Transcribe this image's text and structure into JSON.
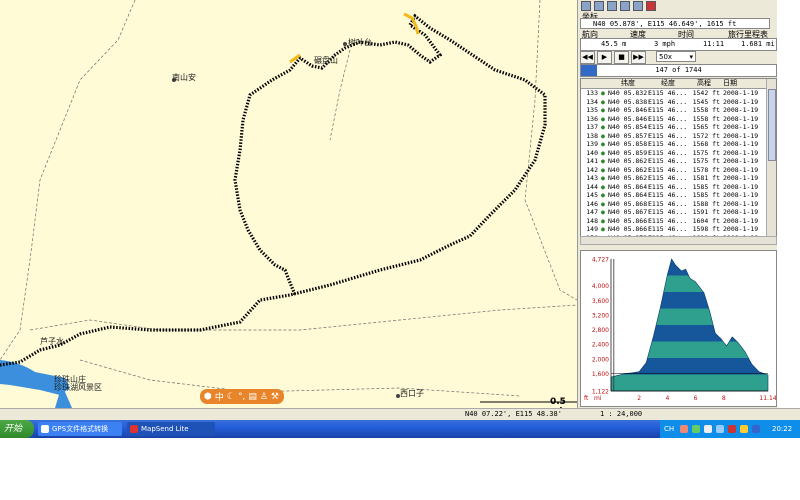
{
  "map": {
    "places": [
      {
        "name": "南山安"
      },
      {
        "name": "碾盘山"
      },
      {
        "name": "树叶台"
      },
      {
        "name": "芦子水"
      },
      {
        "name": "珍珠山庄"
      },
      {
        "name": "珍珠湖风景区"
      },
      {
        "name": "西口子"
      }
    ],
    "scale_label": "0.5 mi",
    "ime_label": "中"
  },
  "panel": {
    "section_title": "坐标",
    "position_value": "N40 05.878',  E115 46.649',  1615 ft",
    "stats_labels": {
      "heading": "航向",
      "speed": "速度",
      "time": "时间",
      "odometer": "旅行里程表"
    },
    "stats_values": {
      "heading": "45.5 m",
      "speed": "3 mph",
      "time": "11:11",
      "odometer": "1.681 mi"
    },
    "playback": {
      "speed": "50x",
      "progress_text": "147 of 1744",
      "progress_fraction": 0.084
    },
    "table": {
      "columns": [
        "",
        "",
        "纬度",
        "经度",
        "高程",
        "日期"
      ],
      "rows": [
        [
          "133",
          "N40 05.832'",
          "E115 46...",
          "1542 ft",
          "2008-1-19"
        ],
        [
          "134",
          "N40 05.838'",
          "E115 46...",
          "1545 ft",
          "2008-1-19"
        ],
        [
          "135",
          "N40 05.846'",
          "E115 46...",
          "1558 ft",
          "2008-1-19"
        ],
        [
          "136",
          "N40 05.846'",
          "E115 46...",
          "1558 ft",
          "2008-1-19"
        ],
        [
          "137",
          "N40 05.854'",
          "E115 46...",
          "1565 ft",
          "2008-1-19"
        ],
        [
          "138",
          "N40 05.857'",
          "E115 46...",
          "1572 ft",
          "2008-1-19"
        ],
        [
          "139",
          "N40 05.858'",
          "E115 46...",
          "1568 ft",
          "2008-1-19"
        ],
        [
          "140",
          "N40 05.859'",
          "E115 46...",
          "1575 ft",
          "2008-1-19"
        ],
        [
          "141",
          "N40 05.862'",
          "E115 46...",
          "1575 ft",
          "2008-1-19"
        ],
        [
          "142",
          "N40 05.862'",
          "E115 46...",
          "1578 ft",
          "2008-1-19"
        ],
        [
          "143",
          "N40 05.862'",
          "E115 46...",
          "1581 ft",
          "2008-1-19"
        ],
        [
          "144",
          "N40 05.864'",
          "E115 46...",
          "1585 ft",
          "2008-1-19"
        ],
        [
          "145",
          "N40 05.864'",
          "E115 46...",
          "1585 ft",
          "2008-1-19"
        ],
        [
          "146",
          "N40 05.868'",
          "E115 46...",
          "1588 ft",
          "2008-1-19"
        ],
        [
          "147",
          "N40 05.867'",
          "E115 46...",
          "1591 ft",
          "2008-1-19"
        ],
        [
          "148",
          "N40 05.866'",
          "E115 46...",
          "1604 ft",
          "2008-1-19"
        ],
        [
          "149",
          "N40 05.866'",
          "E115 46...",
          "1598 ft",
          "2008-1-19"
        ],
        [
          "150",
          "N40 05.872'",
          "E115 46...",
          "1611 ft",
          "2008-1-19"
        ],
        [
          "151",
          "N40 05.872'",
          "E115 46...",
          "1611 ft",
          "2008-1-19"
        ],
        [
          "152",
          "N40 05.882'",
          "E115 46...",
          "1617 ft",
          "2008-1-19"
        ]
      ]
    }
  },
  "chart_data": {
    "type": "area",
    "title": "",
    "ylabel": "ft",
    "xlabel": "mi",
    "y_ticks": [
      1122,
      1600,
      2000,
      2400,
      2800,
      3200,
      3600,
      4000,
      4727
    ],
    "x_ticks": [
      "2",
      "4",
      "6",
      "8",
      "11.14"
    ],
    "ylim": [
      1122,
      4727
    ],
    "xlim": [
      0,
      11.14
    ],
    "x": [
      0,
      0.5,
      1,
      1.5,
      2,
      2.5,
      3,
      3.5,
      4,
      4.3,
      4.6,
      5,
      5.3,
      5.6,
      6,
      6.3,
      6.6,
      7,
      7.4,
      7.8,
      8.2,
      8.6,
      9,
      9.5,
      10,
      10.5,
      11.14
    ],
    "y": [
      1500,
      1550,
      1600,
      1620,
      1650,
      1900,
      2600,
      3400,
      4300,
      4727,
      4550,
      4400,
      4450,
      4200,
      4100,
      3950,
      3800,
      3300,
      2700,
      2550,
      2350,
      2600,
      2450,
      2200,
      1850,
      1650,
      1560
    ],
    "band_colors": [
      "#2fa08e",
      "#16569a"
    ],
    "current_position_x": 0.2
  },
  "statusbar": {
    "coords": "N40 07.22',  E115 48.38'",
    "scale": "1 : 24,000"
  },
  "taskbar": {
    "start": "开始",
    "tasks": [
      "GPS文件格式转换",
      "MapSend Lite"
    ],
    "tray_lang": "CH",
    "clock": "20:22"
  }
}
